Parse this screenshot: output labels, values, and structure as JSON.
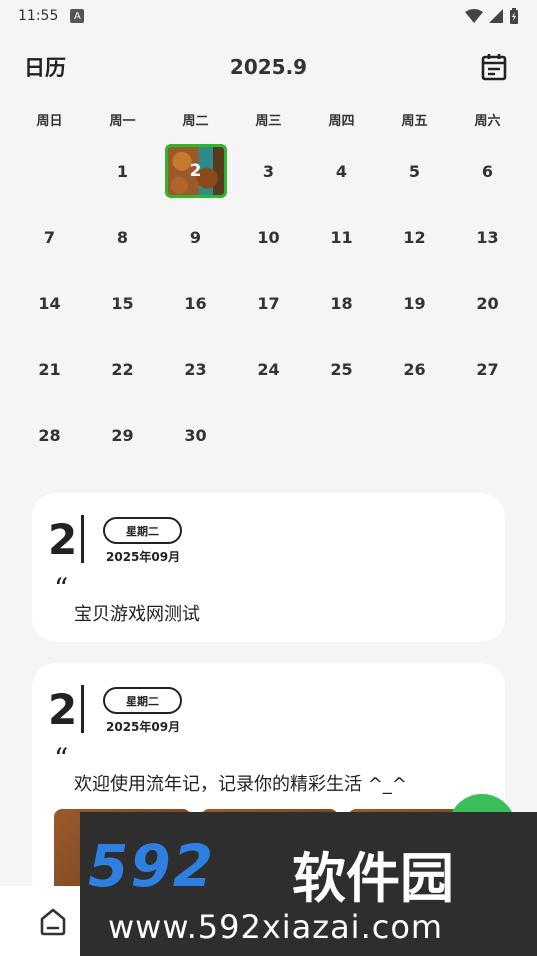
{
  "status_bar": {
    "time": "11:55",
    "badge": "A"
  },
  "header": {
    "title": "日历",
    "month": "2025.9",
    "calendar_icon": "calendar-icon"
  },
  "weekdays": [
    "周日",
    "周一",
    "周二",
    "周三",
    "周四",
    "周五",
    "周六"
  ],
  "days": [
    "",
    "1",
    "2",
    "3",
    "4",
    "5",
    "6",
    "7",
    "8",
    "9",
    "10",
    "11",
    "12",
    "13",
    "14",
    "15",
    "16",
    "17",
    "18",
    "19",
    "20",
    "21",
    "22",
    "23",
    "24",
    "25",
    "26",
    "27",
    "28",
    "29",
    "30"
  ],
  "selected_day": "2",
  "accent_color": "#2fb52f",
  "cards": [
    {
      "day": "2",
      "weekday": "星期二",
      "year_month": "2025年09月",
      "quote_mark": "“",
      "text": "宝贝游戏网测试"
    },
    {
      "day": "2",
      "weekday": "星期二",
      "year_month": "2025年09月",
      "quote_mark": "“",
      "text": "欢迎使用流年记，记录你的精彩生活 ^_^"
    }
  ],
  "bottom_nav": {
    "home_icon": "home-icon"
  },
  "watermark": {
    "logo": "592",
    "brand": "软件园",
    "url": "www.592xiazai.com"
  }
}
